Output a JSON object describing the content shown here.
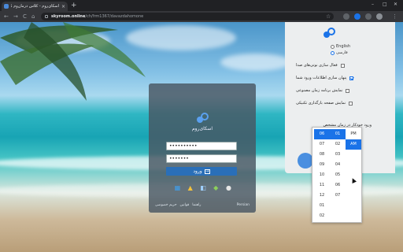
{
  "browser": {
    "tab_title": "اسکای‌روم - کلاس درمان‌وم 3121",
    "tab_close": "×",
    "new_tab": "+",
    "url_host": "skyroom.online",
    "url_path": "/ch/frm1367/davazdahomone",
    "back": "←",
    "forward": "→",
    "reload": "C",
    "home": "⌂",
    "star": "☆",
    "min": "–",
    "max": "□",
    "close": "✕",
    "menu": "⋮"
  },
  "login": {
    "app_name": "اسکای‌روم",
    "username_value": "••••••••••",
    "password_value": "•••••••",
    "submit_label": "ورود",
    "platform_icons": [
      "windows-icon",
      "linux-icon",
      "macos-finder-icon",
      "android-icon",
      "apple-icon"
    ],
    "footer": {
      "links": [
        "حریم خصوصی",
        "قوانین",
        "راهنما"
      ],
      "language": "Persian"
    }
  },
  "settings": {
    "languages": [
      {
        "label": "English",
        "selected": false
      },
      {
        "label": "فارسی",
        "selected": true
      }
    ],
    "options": [
      {
        "label": "فعال سازی نوتی‌های صدا",
        "checked": false
      },
      {
        "label": "پنهان سازی اطلاعات ورود شما",
        "checked": true
      },
      {
        "label": "نمایش برنامه زمان مصنوعی",
        "checked": false
      },
      {
        "label": "نمایش صفحه بارگذاری تکنیکی",
        "checked": false
      }
    ],
    "auto_login_label": "ورود خودکار در زمان مشخص",
    "time": {
      "hour": "06",
      "minute": "01",
      "ampm": "AM"
    }
  },
  "time_picker": {
    "hours": [
      "06",
      "07",
      "08",
      "09",
      "10",
      "11",
      "12",
      "01",
      "02"
    ],
    "minutes": [
      "01",
      "02",
      "03",
      "04",
      "05",
      "06",
      "07"
    ],
    "ampm": [
      "PM",
      "AM"
    ],
    "selected_hour": "06",
    "selected_minute": "01",
    "selected_ampm": "AM"
  },
  "colors": {
    "accent": "#1a73e8",
    "login_button": "#2a6fb8",
    "card": "#485662"
  }
}
